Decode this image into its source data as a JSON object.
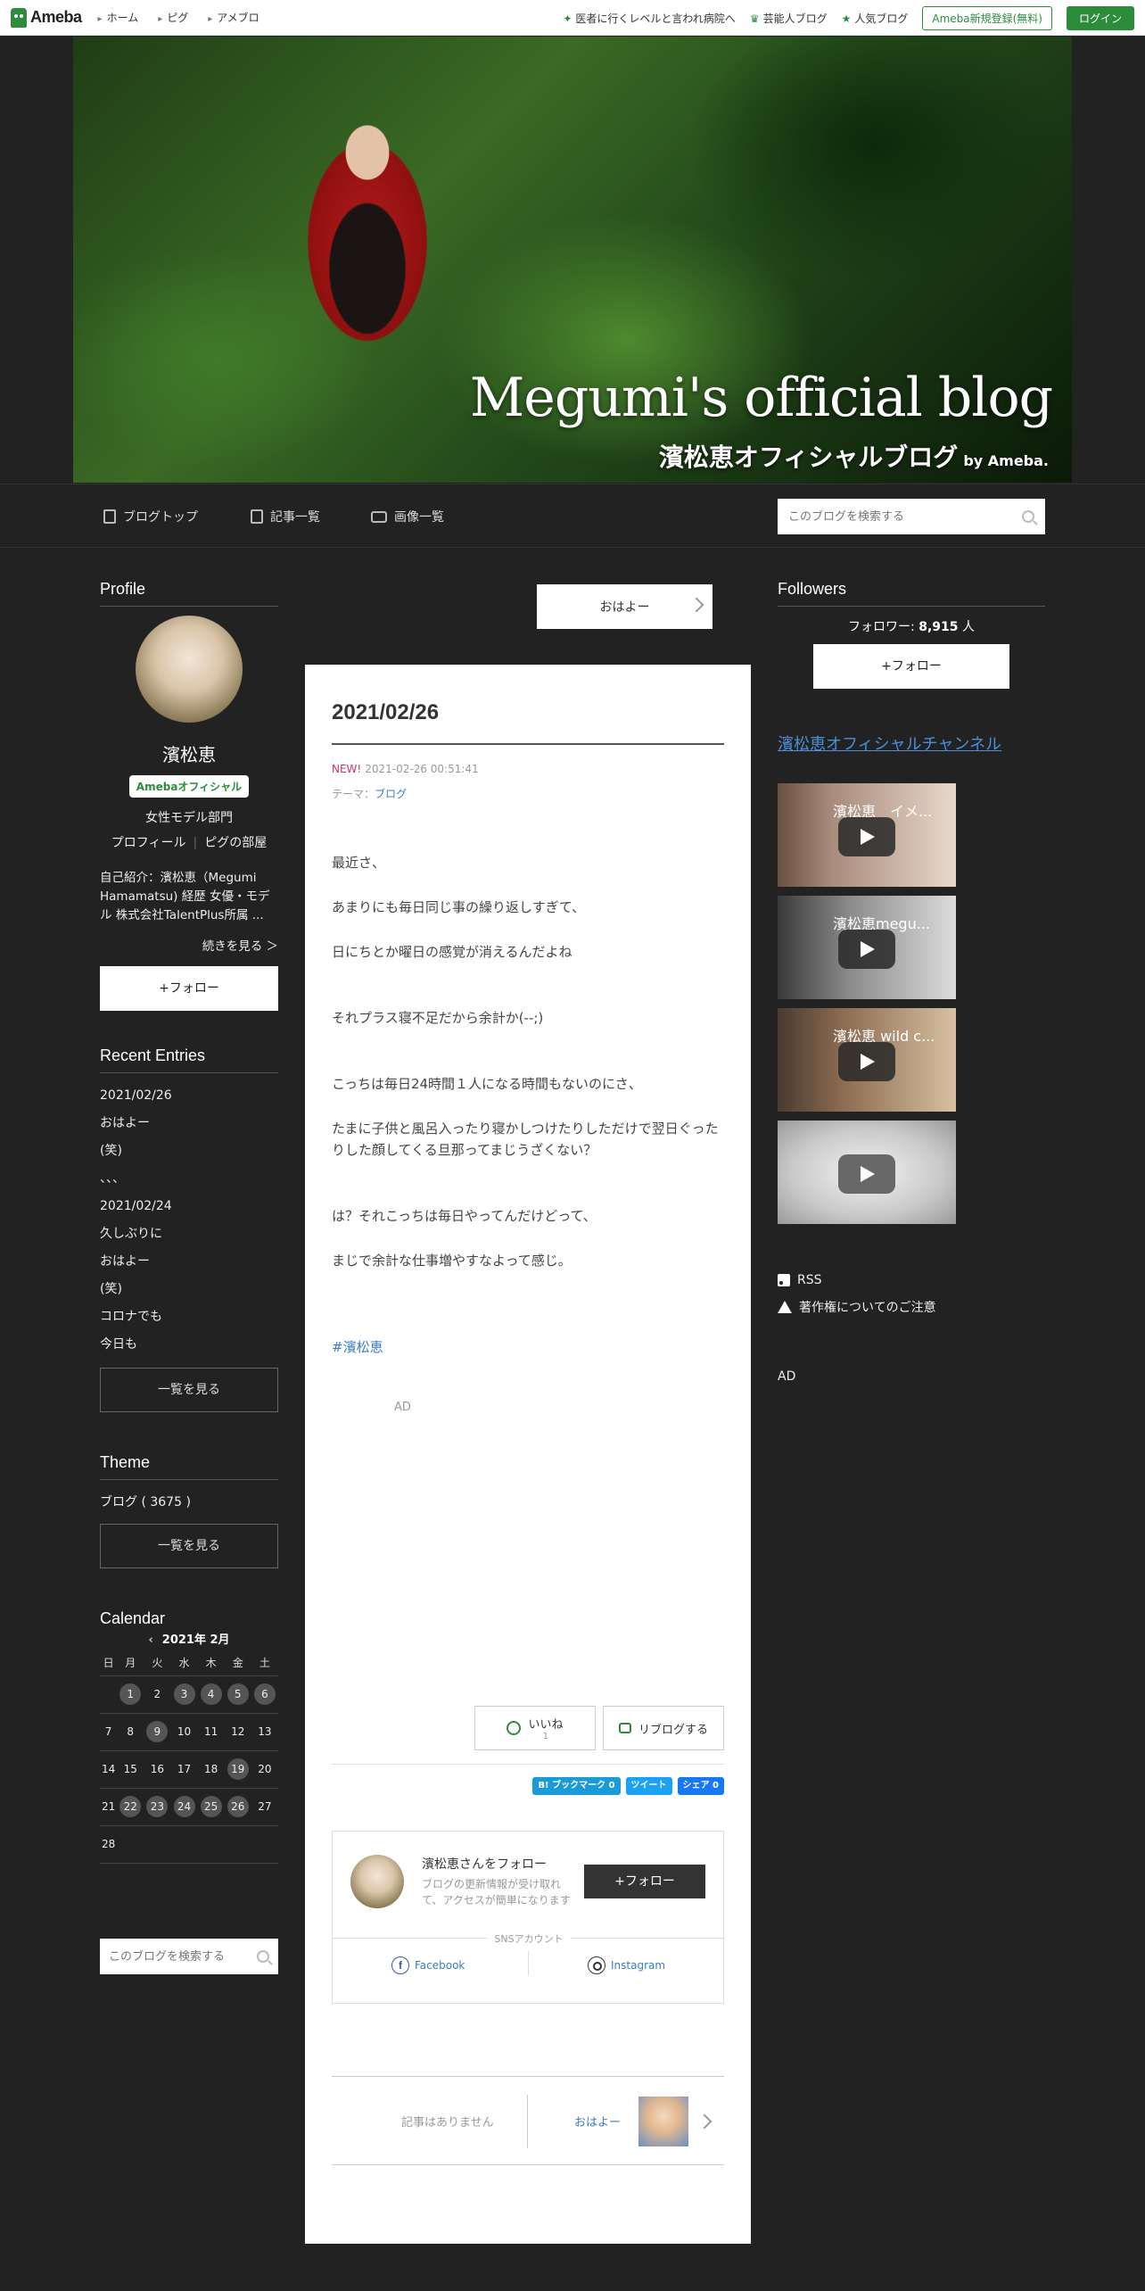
{
  "topbar": {
    "logo": "Ameba",
    "nav": [
      "ホーム",
      "ピグ",
      "アメブロ"
    ],
    "promos": [
      "医者に行くレベルと言われ病院へ",
      "芸能人ブログ",
      "人気ブログ"
    ],
    "register": "Ameba新規登録(無料)",
    "login": "ログイン"
  },
  "header": {
    "title_en": "Megumi's official blog",
    "title_ja": "濱松恵オフィシャルブログ",
    "by": "by Ameba."
  },
  "blognav": {
    "items": [
      "ブログトップ",
      "記事一覧",
      "画像一覧"
    ],
    "search_placeholder": "このブログを検索する"
  },
  "profile": {
    "heading": "Profile",
    "name": "濱松恵",
    "badge": "Amebaオフィシャル",
    "category": "女性モデル部門",
    "links": [
      "プロフィール",
      "ピグの部屋"
    ],
    "intro": "自己紹介：濱松恵（Megumi Hamamatsu) 経歴 女優・モデル 株式会社TalentPlus所属 ...",
    "more": "続きを見る ＞",
    "follow": "+フォロー"
  },
  "recent": {
    "heading": "Recent Entries",
    "items": [
      "2021/02/26",
      "おはよー",
      "(笑)",
      "、、、",
      "2021/02/24",
      "久しぶりに",
      "おはよー",
      "(笑)",
      "コロナでも",
      "今日も"
    ],
    "more": "一覧を見る"
  },
  "theme": {
    "heading": "Theme",
    "item": "ブログ ( 3675 )",
    "more": "一覧を見る"
  },
  "calendar": {
    "heading": "Calendar",
    "month": "2021年 2月",
    "weekdays": [
      "日",
      "月",
      "火",
      "水",
      "木",
      "金",
      "土"
    ],
    "weeks": [
      [
        null,
        {
          "d": "1",
          "has": true
        },
        {
          "d": "2",
          "has": false
        },
        {
          "d": "3",
          "has": true
        },
        {
          "d": "4",
          "has": true
        },
        {
          "d": "5",
          "has": true
        },
        {
          "d": "6",
          "has": true
        }
      ],
      [
        {
          "d": "7",
          "has": false
        },
        {
          "d": "8",
          "has": false
        },
        {
          "d": "9",
          "has": true
        },
        {
          "d": "10",
          "has": false
        },
        {
          "d": "11",
          "has": false
        },
        {
          "d": "12",
          "has": false
        },
        {
          "d": "13",
          "has": false
        }
      ],
      [
        {
          "d": "14",
          "has": false
        },
        {
          "d": "15",
          "has": false
        },
        {
          "d": "16",
          "has": false
        },
        {
          "d": "17",
          "has": false
        },
        {
          "d": "18",
          "has": false
        },
        {
          "d": "19",
          "has": true
        },
        {
          "d": "20",
          "has": false
        }
      ],
      [
        {
          "d": "21",
          "has": false
        },
        {
          "d": "22",
          "has": true
        },
        {
          "d": "23",
          "has": true
        },
        {
          "d": "24",
          "has": true
        },
        {
          "d": "25",
          "has": true
        },
        {
          "d": "26",
          "has": true
        },
        {
          "d": "27",
          "has": false
        }
      ],
      [
        {
          "d": "28",
          "has": false
        },
        null,
        null,
        null,
        null,
        null,
        null
      ]
    ],
    "search_placeholder": "このブログを検索する"
  },
  "center": {
    "next_top": "おはよー",
    "article": {
      "title": "2021/02/26",
      "new": "NEW!",
      "datetime": "2021-02-26 00:51:41",
      "theme_label": "テーマ：",
      "theme": "ブログ",
      "paragraphs": [
        "最近さ、",
        "あまりにも毎日同じ事の繰り返しすぎて、",
        "日にちとか曜日の感覚が消えるんだよね",
        "それプラス寝不足だから余計か(--;)",
        "こっちは毎日24時間１人になる時間もないのにさ、",
        "たまに子供と風呂入ったり寝かしつけたりしただけで翌日ぐったりした顔してくる旦那ってまじうざくない？",
        "は？それこっちは毎日やってんだけどって、",
        "まじで余計な仕事増やすなよって感じ。"
      ],
      "hashtag": "#濱松恵",
      "ad": "AD",
      "like": "いいね",
      "like_count": "1",
      "reblog": "リブログする",
      "share": {
        "hatena": "B! ブックマーク 0",
        "tweet": "ツイート",
        "fb": "シェア 0"
      }
    },
    "follow_card": {
      "name": "濱松恵さんをフォロー",
      "desc": "ブログの更新情報が受け取れて、アクセスが簡単になります",
      "follow": "+フォロー",
      "sns_label": "SNSアカウント",
      "facebook": "Facebook",
      "instagram": "Instagram"
    },
    "pager": {
      "prev": "記事はありません",
      "next": "おはよー"
    }
  },
  "right": {
    "heading": "Followers",
    "followers_label": "フォロワー: ",
    "followers_count": "8,915",
    "followers_unit": " 人",
    "follow": "+フォロー",
    "channel": "濱松恵オフィシャルチャンネル",
    "videos": [
      "濱松恵　イメ...",
      "濱松恵megu...",
      "濱松恵 wild c...",
      ""
    ],
    "rss": "RSS",
    "copyright": "著作権についてのご注意",
    "ad": "AD"
  }
}
